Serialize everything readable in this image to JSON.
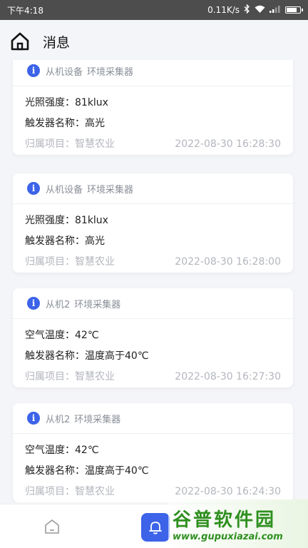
{
  "status_bar": {
    "time": "下午4:18",
    "speed": "0.11K/s",
    "battery_level": 0.85
  },
  "header": {
    "title": "消息"
  },
  "messages": [
    {
      "device": "从机设备",
      "collector": "环境采集器",
      "line1_label": "光照强度：",
      "line1_value": "81klux",
      "line2_label": "触发器名称：",
      "line2_value": "高光",
      "project_label": "归属项目：",
      "project_value": "智慧农业",
      "timestamp": "2022-08-30 16:28:30"
    },
    {
      "device": "从机设备",
      "collector": "环境采集器",
      "line1_label": "光照强度：",
      "line1_value": "81klux",
      "line2_label": "触发器名称：",
      "line2_value": "高光",
      "project_label": "归属项目：",
      "project_value": "智慧农业",
      "timestamp": "2022-08-30 16:28:00"
    },
    {
      "device": "从机2",
      "collector": "环境采集器",
      "line1_label": "空气温度：",
      "line1_value": "42℃",
      "line2_label": "触发器名称：",
      "line2_value": "温度高于40℃",
      "project_label": "归属项目：",
      "project_value": "智慧农业",
      "timestamp": "2022-08-30 16:27:30"
    },
    {
      "device": "从机2",
      "collector": "环境采集器",
      "line1_label": "空气温度：",
      "line1_value": "42℃",
      "line2_label": "触发器名称：",
      "line2_value": "温度高于40℃",
      "project_label": "归属项目：",
      "project_value": "智慧农业",
      "timestamp": "2022-08-30 16:24:30"
    }
  ],
  "tabbar": {
    "items": [
      {
        "icon": "home-icon",
        "active": false
      },
      {
        "icon": "bell-icon",
        "active": true
      }
    ]
  },
  "watermark": {
    "title": "谷普软件园",
    "url": "www.gupuxiazai.com"
  },
  "colors": {
    "accent": "#3c63e8",
    "background": "#f4f5f8",
    "status_bar": "#4d4d4d"
  }
}
